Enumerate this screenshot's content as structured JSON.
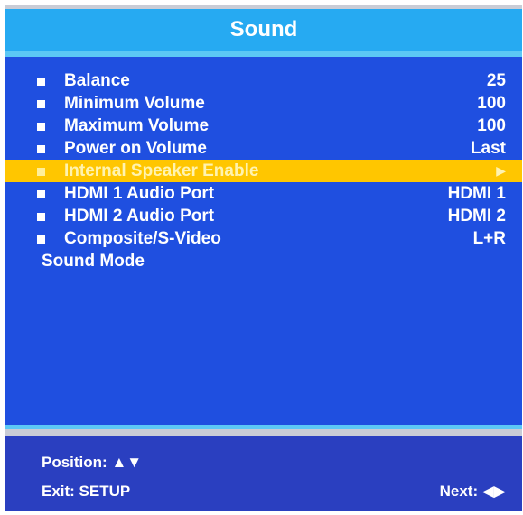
{
  "title": "Sound",
  "items": [
    {
      "label": "Balance",
      "value": "25"
    },
    {
      "label": "Minimum Volume",
      "value": "100"
    },
    {
      "label": "Maximum Volume",
      "value": "100"
    },
    {
      "label": "Power on Volume",
      "value": "Last"
    },
    {
      "label": "Internal Speaker Enable",
      "value": "▶"
    },
    {
      "label": "HDMI 1 Audio Port",
      "value": "HDMI 1"
    },
    {
      "label": "HDMI 2 Audio Port",
      "value": "HDMI 2"
    },
    {
      "label": "Composite/S-Video",
      "value": "L+R"
    }
  ],
  "sound_mode_label": "Sound Mode",
  "footer": {
    "position": "Position: ▲▼",
    "exit": "Exit: SETUP",
    "next": "Next: ◀▶"
  },
  "colors": {
    "menu_background": "#1f4fe0",
    "title_bar": "#26aaf2",
    "selection_highlight": "#ffc600",
    "footer_background": "#2a3fc0"
  }
}
